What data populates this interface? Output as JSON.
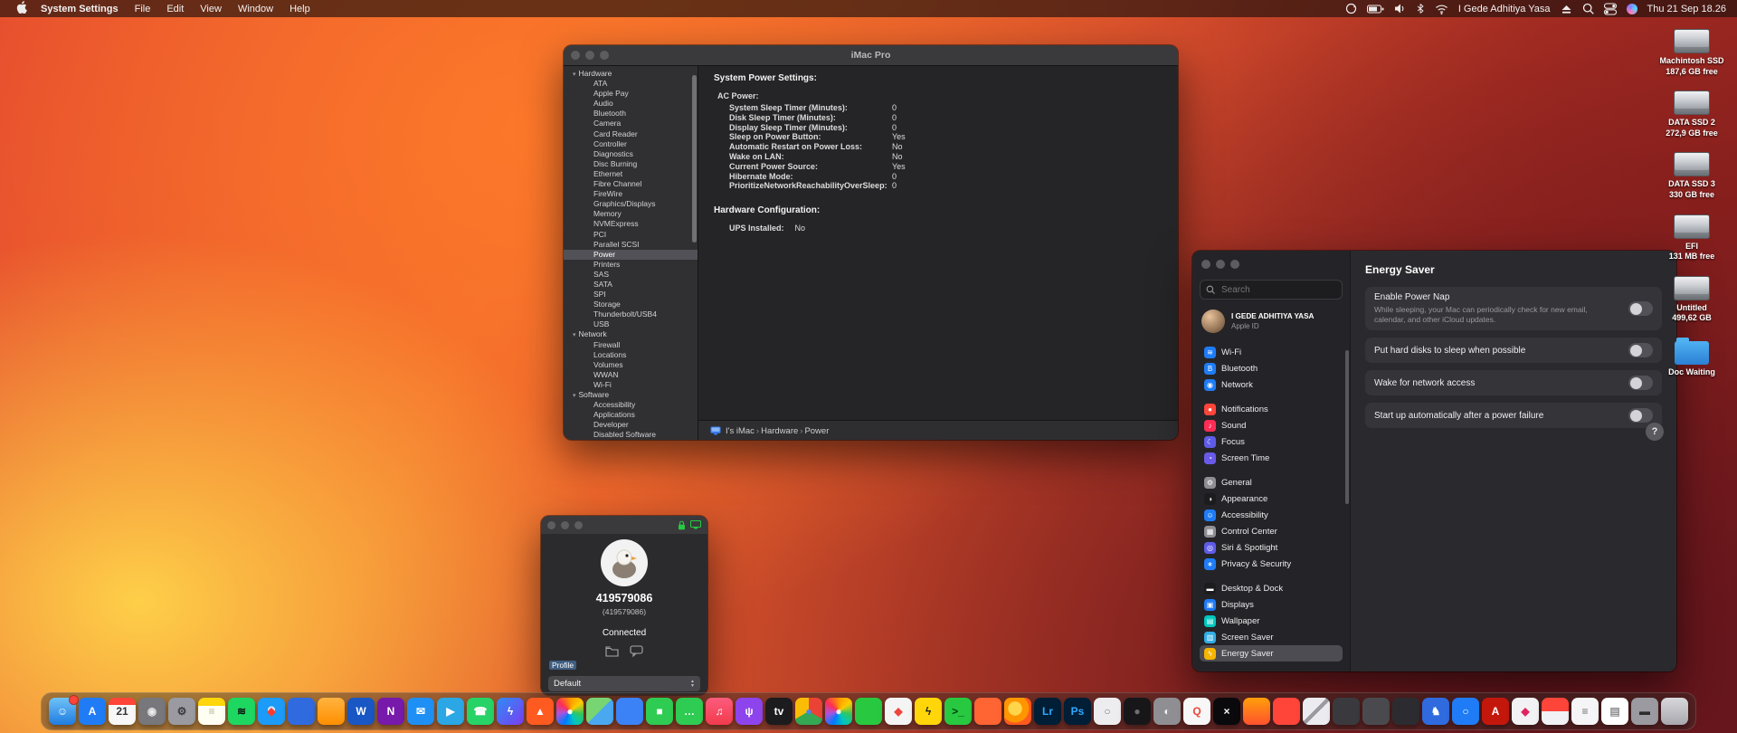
{
  "menu_bar": {
    "app_name": "System Settings",
    "menus": [
      "File",
      "Edit",
      "View",
      "Window",
      "Help"
    ],
    "status": {
      "user_name": "I Gede Adhitiya Yasa",
      "clock": "Thu 21 Sep 18.26",
      "icons": [
        "stats",
        "battery",
        "volume",
        "bluetooth",
        "wifi",
        "eject",
        "spotlight",
        "control-center",
        "siri"
      ]
    }
  },
  "system_information": {
    "window_title": "iMac Pro",
    "sidebar": {
      "selected": "Power",
      "sections": [
        {
          "label": "Hardware",
          "items": [
            "ATA",
            "Apple Pay",
            "Audio",
            "Bluetooth",
            "Camera",
            "Card Reader",
            "Controller",
            "Diagnostics",
            "Disc Burning",
            "Ethernet",
            "Fibre Channel",
            "FireWire",
            "Graphics/Displays",
            "Memory",
            "NVMExpress",
            "PCI",
            "Parallel SCSI",
            "Power",
            "Printers",
            "SAS",
            "SATA",
            "SPI",
            "Storage",
            "Thunderbolt/USB4",
            "USB"
          ]
        },
        {
          "label": "Network",
          "items": [
            "Firewall",
            "Locations",
            "Volumes",
            "WWAN",
            "Wi-Fi"
          ]
        },
        {
          "label": "Software",
          "items": [
            "Accessibility",
            "Applications",
            "Developer",
            "Disabled Software"
          ]
        }
      ]
    },
    "content": {
      "heading": "System Power Settings:",
      "group": "AC Power:",
      "rows": [
        {
          "k": "System Sleep Timer (Minutes):",
          "v": "0"
        },
        {
          "k": "Disk Sleep Timer (Minutes):",
          "v": "0"
        },
        {
          "k": "Display Sleep Timer (Minutes):",
          "v": "0"
        },
        {
          "k": "Sleep on Power Button:",
          "v": "Yes"
        },
        {
          "k": "Automatic Restart on Power Loss:",
          "v": "No"
        },
        {
          "k": "Wake on LAN:",
          "v": "No"
        },
        {
          "k": "Current Power Source:",
          "v": "Yes"
        },
        {
          "k": "Hibernate Mode:",
          "v": "0"
        },
        {
          "k": "PrioritizeNetworkReachabilityOverSleep:",
          "v": "0"
        }
      ],
      "heading2": "Hardware Configuration:",
      "rows2": [
        {
          "k": "UPS Installed:",
          "v": "No"
        }
      ]
    },
    "path_bar": [
      "I's iMac",
      "Hardware",
      "Power"
    ]
  },
  "system_settings": {
    "search_placeholder": "Search",
    "profile": {
      "name": "I GEDE ADHITIYA YASA",
      "subtitle": "Apple ID"
    },
    "sidebar": {
      "selected": "Energy Saver",
      "groups": [
        [
          {
            "label": "Wi-Fi",
            "color": "#1f7cf6",
            "glyph": "≋"
          },
          {
            "label": "Bluetooth",
            "color": "#1f7cf6",
            "glyph": "B"
          },
          {
            "label": "Network",
            "color": "#1f7cf6",
            "glyph": "◉"
          }
        ],
        [
          {
            "label": "Notifications",
            "color": "#ff453a",
            "glyph": "●"
          },
          {
            "label": "Sound",
            "color": "#ff2d55",
            "glyph": "♪"
          },
          {
            "label": "Focus",
            "color": "#5e5ce6",
            "glyph": "☾"
          },
          {
            "label": "Screen Time",
            "color": "#6a5ae8",
            "glyph": "◔"
          }
        ],
        [
          {
            "label": "General",
            "color": "#8e8e93",
            "glyph": "⚙"
          },
          {
            "label": "Appearance",
            "color": "#1c1c1e",
            "glyph": "◑"
          },
          {
            "label": "Accessibility",
            "color": "#1f7cf6",
            "glyph": "☺"
          },
          {
            "label": "Control Center",
            "color": "#8e8e93",
            "glyph": "▦"
          },
          {
            "label": "Siri & Spotlight",
            "color": "#5e5ce6",
            "glyph": "◎"
          },
          {
            "label": "Privacy & Security",
            "color": "#1f7cf6",
            "glyph": "∗"
          }
        ],
        [
          {
            "label": "Desktop & Dock",
            "color": "#1c1c1e",
            "glyph": "▬"
          },
          {
            "label": "Displays",
            "color": "#1f7cf6",
            "glyph": "▣"
          },
          {
            "label": "Wallpaper",
            "color": "#00c7be",
            "glyph": "▤"
          },
          {
            "label": "Screen Saver",
            "color": "#32ade6",
            "glyph": "▥"
          },
          {
            "label": "Energy Saver",
            "color": "#f7b500",
            "glyph": "ϟ"
          }
        ]
      ]
    },
    "pane": {
      "title": "Energy Saver",
      "rows": [
        {
          "label": "Enable Power Nap",
          "description": "While sleeping, your Mac can periodically check for new email, calendar, and other iCloud updates.",
          "on": false
        },
        {
          "label": "Put hard disks to sleep when possible",
          "on": false
        },
        {
          "label": "Wake for network access",
          "on": false
        },
        {
          "label": "Start up automatically after a power failure",
          "on": false
        }
      ],
      "help_label": "?"
    }
  },
  "anydesk": {
    "id": "419579086",
    "alias": "(419579086)",
    "status": "Connected",
    "profile_label": "Profile",
    "profile_value": "Default"
  },
  "desktop_icons": [
    {
      "label": "Machintosh SSD",
      "detail": "187,6 GB free",
      "kind": "drive"
    },
    {
      "label": "DATA SSD 2",
      "detail": "272,9 GB free",
      "kind": "drive"
    },
    {
      "label": "DATA SSD 3",
      "detail": "330 GB free",
      "kind": "drive"
    },
    {
      "label": "EFI",
      "detail": "131 MB free",
      "kind": "drive"
    },
    {
      "label": "Untitled",
      "detail": "499,62 GB",
      "kind": "drive"
    },
    {
      "label": "Doc Waiting",
      "detail": "",
      "kind": "folder"
    }
  ],
  "dock": {
    "icons": [
      {
        "n": "finder",
        "g": "☺",
        "bg": "linear-gradient(180deg,#6fc2f7,#1f7ce0)",
        "fg": "#fff",
        "b": true
      },
      {
        "n": "app-store",
        "g": "A",
        "bg": "#1f7cf6",
        "fg": "#fff"
      },
      {
        "n": "calendar",
        "g": "21",
        "bg": "linear-gradient(180deg,#ff4538 0%,#ff4538 26%,#f7f7f7 26%)",
        "fg": "#333"
      },
      {
        "n": "photo-booth",
        "g": "◉",
        "bg": "#77777c",
        "fg": "#e8e8e8"
      },
      {
        "n": "system-settings",
        "g": "⚙",
        "bg": "#9a9aa0",
        "fg": "#3a3a3c"
      },
      {
        "n": "notes",
        "g": "≡",
        "bg": "linear-gradient(180deg,#ffd60a 0%,#ffd60a 30%,#fffef2 30%)",
        "fg": "#b9b39a"
      },
      {
        "n": "spotify",
        "g": "≋",
        "bg": "#1ed760",
        "fg": "#0b0b0b"
      },
      {
        "n": "safari",
        "g": "◆",
        "bg": "radial-gradient(circle at 50% 45%,#cfe9ff 0 18%,#1c9bf8 19%)",
        "fg": "#ff3b30"
      },
      {
        "n": "blue-app",
        "g": "",
        "bg": "#2f6bdf",
        "fg": "#fff"
      },
      {
        "n": "orange-app",
        "g": "",
        "bg": "linear-gradient(180deg,#ffb340,#ff8f00)",
        "fg": "#fff"
      },
      {
        "n": "word",
        "g": "W",
        "bg": "#1857c4",
        "fg": "#fff"
      },
      {
        "n": "onenote",
        "g": "N",
        "bg": "#7719aa",
        "fg": "#fff"
      },
      {
        "n": "mail",
        "g": "✉",
        "bg": "#1e90f5",
        "fg": "#fff"
      },
      {
        "n": "telegram",
        "g": "▶",
        "bg": "#2aa7e4",
        "fg": "#fff"
      },
      {
        "n": "whatsapp",
        "g": "☎",
        "bg": "#27d366",
        "fg": "#fff"
      },
      {
        "n": "messenger",
        "g": "ϟ",
        "bg": "linear-gradient(135deg,#2e8df6,#7a3df0)",
        "fg": "#fff"
      },
      {
        "n": "brave",
        "g": "▲",
        "bg": "#ff5a1f",
        "fg": "#fff"
      },
      {
        "n": "photos",
        "g": "●",
        "bg": "conic-gradient(#ff9500,#ffcc00,#34c759,#00c7be,#007aff,#af52de,#ff2d55,#ff9500)",
        "fg": "#fff"
      },
      {
        "n": "maps",
        "g": "",
        "bg": "linear-gradient(135deg,#77d572 0 50%,#4aa8f0 50%)",
        "fg": "#fff"
      },
      {
        "n": "blue-cloud-app",
        "g": "",
        "bg": "#3b82f6",
        "fg": "#fff"
      },
      {
        "n": "facetime",
        "g": "■",
        "bg": "#2ecc52",
        "fg": "#fff"
      },
      {
        "n": "messages",
        "g": "…",
        "bg": "#2ecc52",
        "fg": "#fff"
      },
      {
        "n": "music",
        "g": "♫",
        "bg": "linear-gradient(180deg,#fc5c7d,#f23b4d)",
        "fg": "#fff"
      },
      {
        "n": "podcasts",
        "g": "ψ",
        "bg": "#8e44ec",
        "fg": "#fff"
      },
      {
        "n": "tv",
        "g": "tv",
        "bg": "#1c1c1e",
        "fg": "#fff"
      },
      {
        "n": "chrome",
        "g": "●",
        "bg": "conic-gradient(#ea4335 0 120deg,#34a853 120deg 240deg,#fbbc05 240deg 360deg)",
        "fg": "#4285f4"
      },
      {
        "n": "colorful-app",
        "g": "●",
        "bg": "conic-gradient(#ff9500,#ffcc00,#34c759,#00c7be,#007aff,#af52de,#ff2d55,#ff9500)",
        "fg": "#f2f2f2"
      },
      {
        "n": "green-app",
        "g": "",
        "bg": "#28c840",
        "fg": "#fff"
      },
      {
        "n": "anydesk",
        "g": "◆",
        "bg": "#f4f4f4",
        "fg": "#ef443b"
      },
      {
        "n": "zap-app",
        "g": "ϟ",
        "bg": "#ffd60a",
        "fg": "#1c1c1e"
      },
      {
        "n": "green-terminal",
        "g": ">_",
        "bg": "#28c840",
        "fg": "#003f0f"
      },
      {
        "n": "red-orange-app",
        "g": "",
        "bg": "#ff6433",
        "fg": "#fff"
      },
      {
        "n": "firefox",
        "g": "",
        "bg": "radial-gradient(circle at 40% 40%,#ffd54a 0 30%,#ff9500 31% 60%,#ff5a1f 61%)",
        "fg": "#fff"
      },
      {
        "n": "lightroom",
        "g": "Lr",
        "bg": "#001e36",
        "fg": "#31a8ff"
      },
      {
        "n": "photoshop",
        "g": "Ps",
        "bg": "#001e36",
        "fg": "#31a8ff"
      },
      {
        "n": "white-circle-app",
        "g": "○",
        "bg": "#ededf0",
        "fg": "#7a7a80"
      },
      {
        "n": "black-circle-app",
        "g": "●",
        "bg": "#17171a",
        "fg": "#6e6e73"
      },
      {
        "n": "gray-sphere-app",
        "g": "◐",
        "bg": "#8e8e93",
        "fg": "#f2f2f7"
      },
      {
        "n": "qq",
        "g": "Q",
        "bg": "#f7f7f7",
        "fg": "#ef4339"
      },
      {
        "n": "x-app",
        "g": "×",
        "bg": "#0a0a0c",
        "fg": "#fff"
      },
      {
        "n": "flame-app",
        "g": "",
        "bg": "linear-gradient(180deg,#ff9f0a,#ff512e)",
        "fg": "#fff"
      },
      {
        "n": "red-app",
        "g": "",
        "bg": "#ff453a",
        "fg": "#fff"
      },
      {
        "n": "clip-app",
        "g": "",
        "bg": "linear-gradient(135deg,#ececf0 45%,#9a9aa0 45% 55%,#ececf0 55%)",
        "fg": "#555"
      },
      {
        "n": "dark-app-1",
        "g": "",
        "bg": "#3a3a3e",
        "fg": "#fff"
      },
      {
        "n": "dark-app-2",
        "g": "",
        "bg": "#4a4a4e",
        "fg": "#fff"
      },
      {
        "n": "dark-app-3",
        "g": "",
        "bg": "#2c2c30",
        "fg": "#fff"
      },
      {
        "n": "chess-app",
        "g": "♞",
        "bg": "#2f6bdf",
        "fg": "#fff"
      },
      {
        "n": "search-app",
        "g": "○",
        "bg": "#1f7cf6",
        "fg": "#fff"
      },
      {
        "n": "acrobat",
        "g": "A",
        "bg": "#c4170c",
        "fg": "#fff"
      },
      {
        "n": "red-diamond-app",
        "g": "◆",
        "bg": "#f2f2f4",
        "fg": "#e0245e"
      },
      {
        "n": "red-white-app",
        "g": "",
        "bg": "linear-gradient(180deg,#ff453a 0 50%,#f2f2f4 50%)",
        "fg": "#fff"
      },
      {
        "n": "documents-app",
        "g": "≡",
        "bg": "#f5f5f7",
        "fg": "#6e6e73"
      },
      {
        "n": "page-app",
        "g": "▤",
        "bg": "#ffffff",
        "fg": "#8e8e93"
      },
      {
        "n": "printer-app",
        "g": "▬",
        "bg": "#9a9aa0",
        "fg": "#2c2c2e"
      },
      {
        "n": "trash",
        "g": "",
        "bg": "linear-gradient(180deg,#d8d8dc,#a8a8ae)",
        "fg": "#555"
      }
    ]
  }
}
